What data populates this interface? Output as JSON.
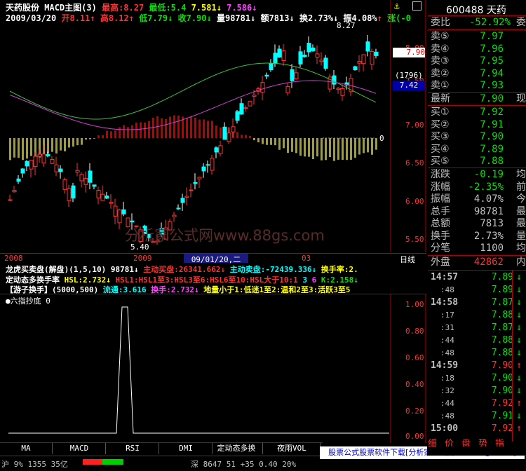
{
  "header": {
    "stock_name": "天药股份",
    "indicator": "MACD主图(3)",
    "high_label": "最高:8.27",
    "low_label": "最低:5.4",
    "v1": "7.581",
    "v2": "7.586"
  },
  "quote_line": {
    "date": "2009/03/20",
    "open": "开8.11",
    "high": "高8.12",
    "low": "低7.79",
    "close": "收7.90",
    "volume": "量98781",
    "amount": "额7813",
    "turnover": "换2.73%",
    "amplitude": "振4.08%",
    "change": "涨(-0"
  },
  "price_axis": [
    "8.00",
    "7.50",
    "7.00",
    "6.50",
    "6.00",
    "5.50"
  ],
  "price_tags": {
    "current": "7.90",
    "bracket": "(1796)",
    "ma": "7.42",
    "zero": "0"
  },
  "chart_labels": {
    "top_mark": "8.27",
    "bottom_mark": "5.40"
  },
  "time_axis": {
    "left": "2008",
    "mid": "2009",
    "date": "09/01/20,二",
    "right": "03",
    "daily": "日线"
  },
  "indicator_lines": {
    "line1_name": "龙虎买卖盘(解盘)(1,5,10)",
    "line1_vol": "98781",
    "line1_buy": "主动买盘:26341.662",
    "line1_sell": "主动卖盘:-72439.336",
    "line1_turn": "换手率:2.",
    "line2_name": "定动态多换手率",
    "line2_hsl": "HSL:2.732",
    "line2_a": "HSL1:HSL1至3:HSL3至6:HSL6至10:HSL大于10:1",
    "line2_nums": "3",
    "line2_n6": "6",
    "line2_k": "K:2.158",
    "line3_name": "【游子换手】(5000,500)",
    "line3_flow": "流通:3.616",
    "line3_hs": "换手:2.732",
    "line3_rest": "地量小于1:低迷1至2:温和2至3:活跃3至5"
  },
  "sub_chart": {
    "title": "●六指抄底 0",
    "axis": [
      "1.00",
      "0.80",
      "0.60",
      "0.40",
      "0.20",
      "0.00"
    ]
  },
  "watermark": "分析家公式网www.88gs.com",
  "bottom_tabs": [
    "MA",
    "MACD",
    "RSI",
    "DMI",
    "定动态多换",
    "夜雨VOL"
  ],
  "status_bar": {
    "left": "沪 9%  1355  35亿",
    "mid": "深 8647  51 +35  0.40  20%",
    "banner": "股票公式股票软件下载[分析家公式网www.88gs.com]"
  },
  "order_book": {
    "code": "600488",
    "name": "天药",
    "weibi_label": "委比",
    "weibi": "-52.92%",
    "weibi_tail": "委",
    "sells": [
      {
        "label": "卖⑤",
        "price": "7.97"
      },
      {
        "label": "卖④",
        "price": "7.96"
      },
      {
        "label": "卖③",
        "price": "7.95"
      },
      {
        "label": "卖②",
        "price": "7.94"
      },
      {
        "label": "卖①",
        "price": "7.93"
      }
    ],
    "latest_label": "最新",
    "latest": "7.90",
    "latest_tail": "现",
    "buys": [
      {
        "label": "买①",
        "price": "7.92"
      },
      {
        "label": "买②",
        "price": "7.91"
      },
      {
        "label": "买③",
        "price": "7.90"
      },
      {
        "label": "买④",
        "price": "7.89"
      },
      {
        "label": "买⑤",
        "price": "7.88"
      }
    ],
    "stats": [
      {
        "label": "涨跌",
        "value": "-0.19",
        "tail": "均",
        "cls": "grn"
      },
      {
        "label": "涨幅",
        "value": "-2.35%",
        "tail": "前",
        "cls": "grn"
      },
      {
        "label": "振幅",
        "value": "4.07%",
        "tail": "今",
        "cls": "gry"
      },
      {
        "label": "总手",
        "value": "98781",
        "tail": "最",
        "cls": "gry"
      },
      {
        "label": "总额",
        "value": "7813",
        "tail": "最",
        "cls": "gry"
      },
      {
        "label": "换手",
        "value": "2.73%",
        "tail": "量",
        "cls": "gry"
      },
      {
        "label": "分笔",
        "value": "1100",
        "tail": "均",
        "cls": "gry"
      }
    ],
    "outer_label": "外盘",
    "outer": "42862",
    "outer_tail": "内",
    "ticks": [
      {
        "t": "14:57",
        "p": "7.89",
        "c": "grn",
        "big": true
      },
      {
        "t": ":48",
        "p": "7.89",
        "c": "grn",
        "big": false
      },
      {
        "t": "14:58",
        "p": "7.87",
        "c": "grn",
        "big": true
      },
      {
        "t": ":17",
        "p": "7.88",
        "c": "grn",
        "big": false
      },
      {
        "t": ":31",
        "p": "7.87",
        "c": "grn",
        "big": false
      },
      {
        "t": ":44",
        "p": "7.88",
        "c": "grn",
        "big": false
      },
      {
        "t": ":48",
        "p": "7.88",
        "c": "grn",
        "big": false
      },
      {
        "t": "14:59",
        "p": "7.90",
        "c": "red",
        "big": true
      },
      {
        "t": ":18",
        "p": "7.90",
        "c": "grn",
        "big": false
      },
      {
        "t": ":32",
        "p": "7.90",
        "c": "grn",
        "big": false
      },
      {
        "t": ":44",
        "p": "7.92",
        "c": "red",
        "big": false
      },
      {
        "t": ":48",
        "p": "7.91",
        "c": "grn",
        "big": false
      },
      {
        "t": "15:00",
        "p": "7.92",
        "c": "red",
        "big": true
      }
    ],
    "bottom_tabs": [
      "细",
      "价",
      "盘",
      "势",
      "指"
    ]
  }
}
